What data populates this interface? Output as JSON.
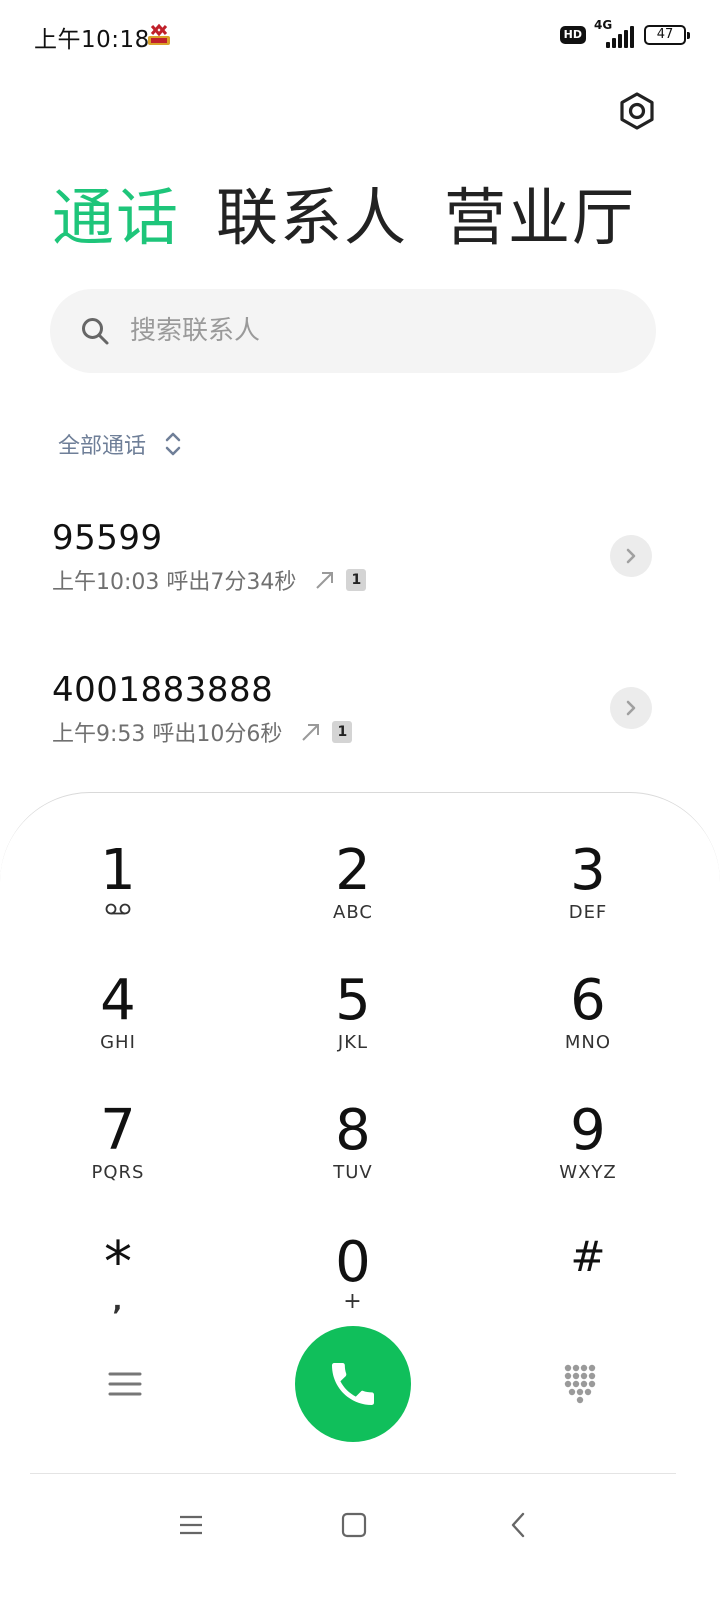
{
  "status_bar": {
    "time": "上午10:18",
    "hd_label": "HD",
    "network": "4G",
    "battery": "47"
  },
  "tabs": [
    {
      "label": "通话",
      "active": true
    },
    {
      "label": "联系人",
      "active": false
    },
    {
      "label": "营业厅",
      "active": false
    }
  ],
  "search": {
    "placeholder": "搜索联系人"
  },
  "filter": {
    "label": "全部通话"
  },
  "calls": [
    {
      "number": "95599",
      "time": "上午10:03",
      "detail": "呼出7分34秒",
      "sim": "1"
    },
    {
      "number": "4001883888",
      "time": "上午9:53",
      "detail": "呼出10分6秒",
      "sim": "1"
    }
  ],
  "dialpad": {
    "keys": [
      {
        "digit": "1",
        "letters": ""
      },
      {
        "digit": "2",
        "letters": "ABC"
      },
      {
        "digit": "3",
        "letters": "DEF"
      },
      {
        "digit": "4",
        "letters": "GHI"
      },
      {
        "digit": "5",
        "letters": "JKL"
      },
      {
        "digit": "6",
        "letters": "MNO"
      },
      {
        "digit": "7",
        "letters": "PQRS"
      },
      {
        "digit": "8",
        "letters": "TUV"
      },
      {
        "digit": "9",
        "letters": "WXYZ"
      },
      {
        "digit": "*",
        "letters": ","
      },
      {
        "digit": "0",
        "letters": "+"
      },
      {
        "digit": "#",
        "letters": ""
      }
    ]
  },
  "colors": {
    "accent": "#1ec57a",
    "call_button": "#10bf5b",
    "filter_text": "#6f7f98"
  }
}
